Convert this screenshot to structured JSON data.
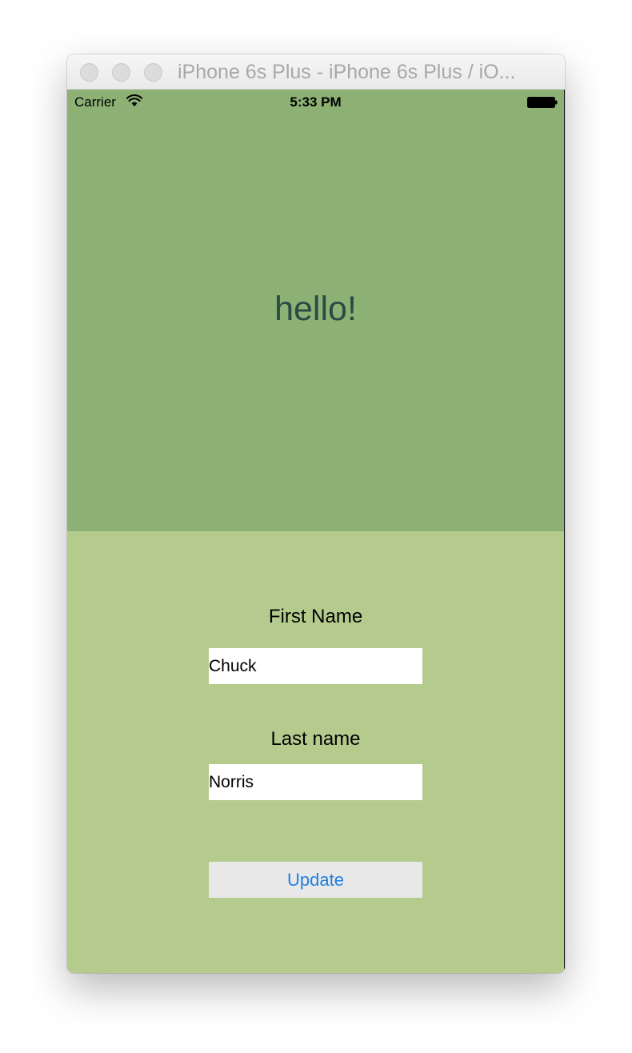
{
  "window": {
    "title": "iPhone 6s Plus - iPhone 6s Plus / iO..."
  },
  "status_bar": {
    "carrier": "Carrier",
    "time": "5:33 PM",
    "icons": [
      "wifi-icon",
      "battery-icon"
    ]
  },
  "top_pane": {
    "greeting": "hello!",
    "background": "#8db174",
    "text_color": "#2a4a46"
  },
  "form": {
    "background": "#b5cb8e",
    "first_name_label": "First Name",
    "first_name_value": "Chuck",
    "last_name_label": "Last name",
    "last_name_value": "Norris",
    "update_button_label": "Update",
    "button_text_color": "#1f7fe0"
  }
}
